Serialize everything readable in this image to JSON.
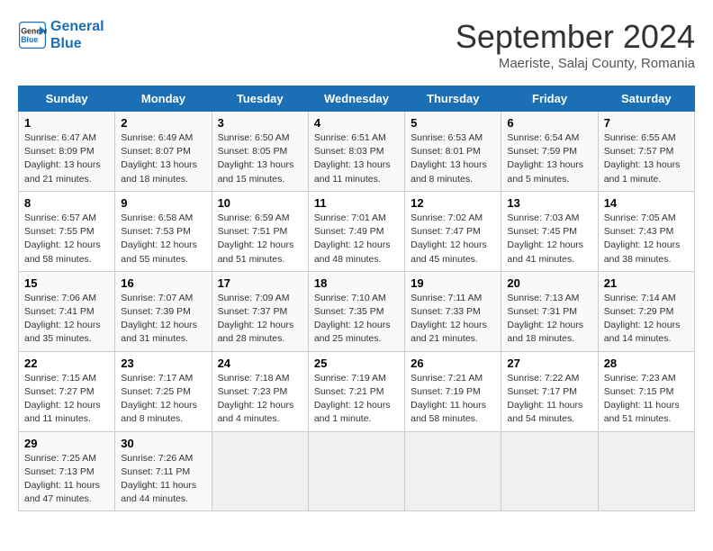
{
  "header": {
    "logo_line1": "General",
    "logo_line2": "Blue",
    "month": "September 2024",
    "location": "Maeriste, Salaj County, Romania"
  },
  "weekdays": [
    "Sunday",
    "Monday",
    "Tuesday",
    "Wednesday",
    "Thursday",
    "Friday",
    "Saturday"
  ],
  "weeks": [
    [
      {
        "day": "1",
        "info": "Sunrise: 6:47 AM\nSunset: 8:09 PM\nDaylight: 13 hours and 21 minutes."
      },
      {
        "day": "2",
        "info": "Sunrise: 6:49 AM\nSunset: 8:07 PM\nDaylight: 13 hours and 18 minutes."
      },
      {
        "day": "3",
        "info": "Sunrise: 6:50 AM\nSunset: 8:05 PM\nDaylight: 13 hours and 15 minutes."
      },
      {
        "day": "4",
        "info": "Sunrise: 6:51 AM\nSunset: 8:03 PM\nDaylight: 13 hours and 11 minutes."
      },
      {
        "day": "5",
        "info": "Sunrise: 6:53 AM\nSunset: 8:01 PM\nDaylight: 13 hours and 8 minutes."
      },
      {
        "day": "6",
        "info": "Sunrise: 6:54 AM\nSunset: 7:59 PM\nDaylight: 13 hours and 5 minutes."
      },
      {
        "day": "7",
        "info": "Sunrise: 6:55 AM\nSunset: 7:57 PM\nDaylight: 13 hours and 1 minute."
      }
    ],
    [
      {
        "day": "8",
        "info": "Sunrise: 6:57 AM\nSunset: 7:55 PM\nDaylight: 12 hours and 58 minutes."
      },
      {
        "day": "9",
        "info": "Sunrise: 6:58 AM\nSunset: 7:53 PM\nDaylight: 12 hours and 55 minutes."
      },
      {
        "day": "10",
        "info": "Sunrise: 6:59 AM\nSunset: 7:51 PM\nDaylight: 12 hours and 51 minutes."
      },
      {
        "day": "11",
        "info": "Sunrise: 7:01 AM\nSunset: 7:49 PM\nDaylight: 12 hours and 48 minutes."
      },
      {
        "day": "12",
        "info": "Sunrise: 7:02 AM\nSunset: 7:47 PM\nDaylight: 12 hours and 45 minutes."
      },
      {
        "day": "13",
        "info": "Sunrise: 7:03 AM\nSunset: 7:45 PM\nDaylight: 12 hours and 41 minutes."
      },
      {
        "day": "14",
        "info": "Sunrise: 7:05 AM\nSunset: 7:43 PM\nDaylight: 12 hours and 38 minutes."
      }
    ],
    [
      {
        "day": "15",
        "info": "Sunrise: 7:06 AM\nSunset: 7:41 PM\nDaylight: 12 hours and 35 minutes."
      },
      {
        "day": "16",
        "info": "Sunrise: 7:07 AM\nSunset: 7:39 PM\nDaylight: 12 hours and 31 minutes."
      },
      {
        "day": "17",
        "info": "Sunrise: 7:09 AM\nSunset: 7:37 PM\nDaylight: 12 hours and 28 minutes."
      },
      {
        "day": "18",
        "info": "Sunrise: 7:10 AM\nSunset: 7:35 PM\nDaylight: 12 hours and 25 minutes."
      },
      {
        "day": "19",
        "info": "Sunrise: 7:11 AM\nSunset: 7:33 PM\nDaylight: 12 hours and 21 minutes."
      },
      {
        "day": "20",
        "info": "Sunrise: 7:13 AM\nSunset: 7:31 PM\nDaylight: 12 hours and 18 minutes."
      },
      {
        "day": "21",
        "info": "Sunrise: 7:14 AM\nSunset: 7:29 PM\nDaylight: 12 hours and 14 minutes."
      }
    ],
    [
      {
        "day": "22",
        "info": "Sunrise: 7:15 AM\nSunset: 7:27 PM\nDaylight: 12 hours and 11 minutes."
      },
      {
        "day": "23",
        "info": "Sunrise: 7:17 AM\nSunset: 7:25 PM\nDaylight: 12 hours and 8 minutes."
      },
      {
        "day": "24",
        "info": "Sunrise: 7:18 AM\nSunset: 7:23 PM\nDaylight: 12 hours and 4 minutes."
      },
      {
        "day": "25",
        "info": "Sunrise: 7:19 AM\nSunset: 7:21 PM\nDaylight: 12 hours and 1 minute."
      },
      {
        "day": "26",
        "info": "Sunrise: 7:21 AM\nSunset: 7:19 PM\nDaylight: 11 hours and 58 minutes."
      },
      {
        "day": "27",
        "info": "Sunrise: 7:22 AM\nSunset: 7:17 PM\nDaylight: 11 hours and 54 minutes."
      },
      {
        "day": "28",
        "info": "Sunrise: 7:23 AM\nSunset: 7:15 PM\nDaylight: 11 hours and 51 minutes."
      }
    ],
    [
      {
        "day": "29",
        "info": "Sunrise: 7:25 AM\nSunset: 7:13 PM\nDaylight: 11 hours and 47 minutes."
      },
      {
        "day": "30",
        "info": "Sunrise: 7:26 AM\nSunset: 7:11 PM\nDaylight: 11 hours and 44 minutes."
      },
      {
        "day": "",
        "info": ""
      },
      {
        "day": "",
        "info": ""
      },
      {
        "day": "",
        "info": ""
      },
      {
        "day": "",
        "info": ""
      },
      {
        "day": "",
        "info": ""
      }
    ]
  ]
}
